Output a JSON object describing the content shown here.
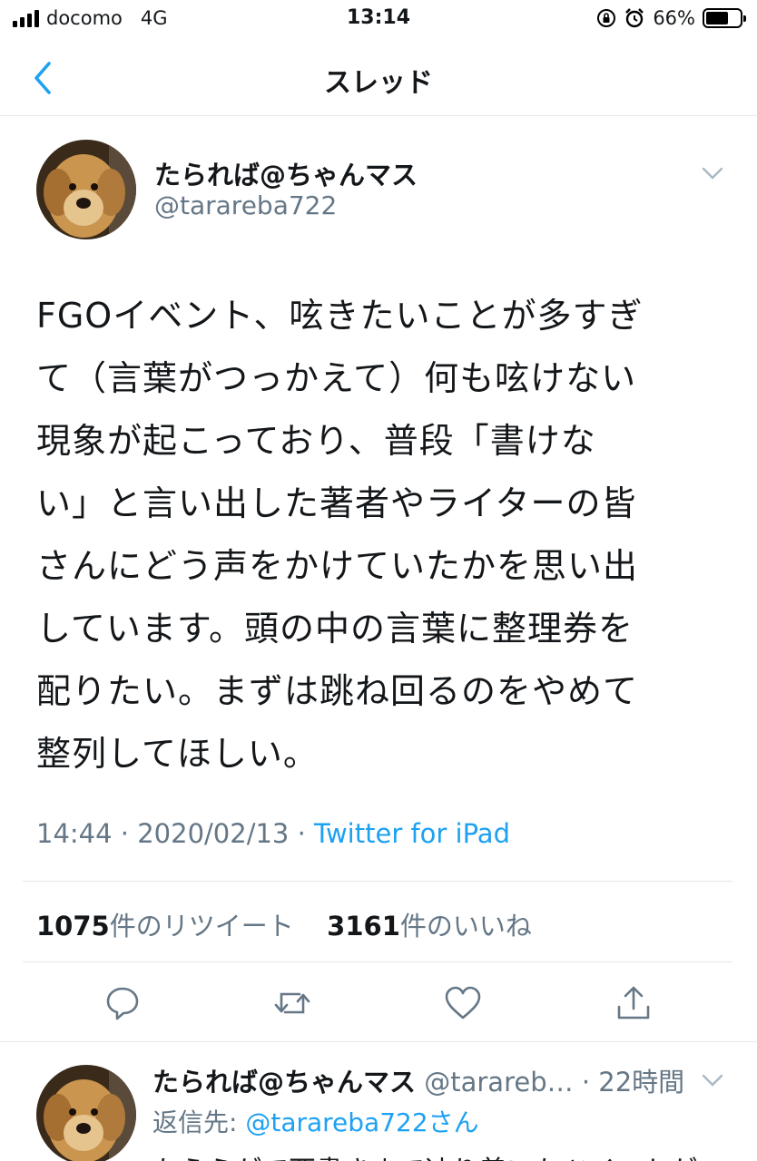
{
  "status_bar": {
    "carrier": "docomo",
    "network": "4G",
    "time": "13:14",
    "battery_percent": "66%",
    "battery_level": 0.66
  },
  "nav": {
    "title": "スレッド",
    "back_icon": "chevron-left-icon"
  },
  "tweet": {
    "display_name": "たられば@ちゃんマス",
    "handle": "@tarareba722",
    "text": "FGOイベント、呟きたいことが多すぎ\nて（言葉がつっかえて）何も呟けない\n現象が起こっており、普段「書けな\nい」と言い出した著者やライターの皆\nさんにどう声をかけていたかを思い出\nしています。頭の中の言葉に整理券を\n配りたい。まずは跳ね回るのをやめて\n整列してほしい。",
    "time": "14:44",
    "sep1": " · ",
    "date": "2020/02/13",
    "sep2": " · ",
    "source": "Twitter for iPad",
    "retweets_count": "1075",
    "retweets_label": "件のリツイート",
    "likes_count": "3161",
    "likes_label": "件のいいね"
  },
  "actions": {
    "reply_icon": "reply-icon",
    "retweet_icon": "retweet-icon",
    "like_icon": "heart-icon",
    "share_icon": "share-icon"
  },
  "reply": {
    "display_name": "たられば@ちゃんマス",
    "handle": " @tarareb…",
    "time": " · 22時間",
    "reply_to_label": "返信先: ",
    "reply_to_handle": "@tarareba722さん",
    "text_preview": "たえらがて西書きまで辿り着いたツイートが"
  },
  "colors": {
    "accent": "#1da1f2",
    "secondary_text": "#657786",
    "divider": "#e1e8ed"
  }
}
